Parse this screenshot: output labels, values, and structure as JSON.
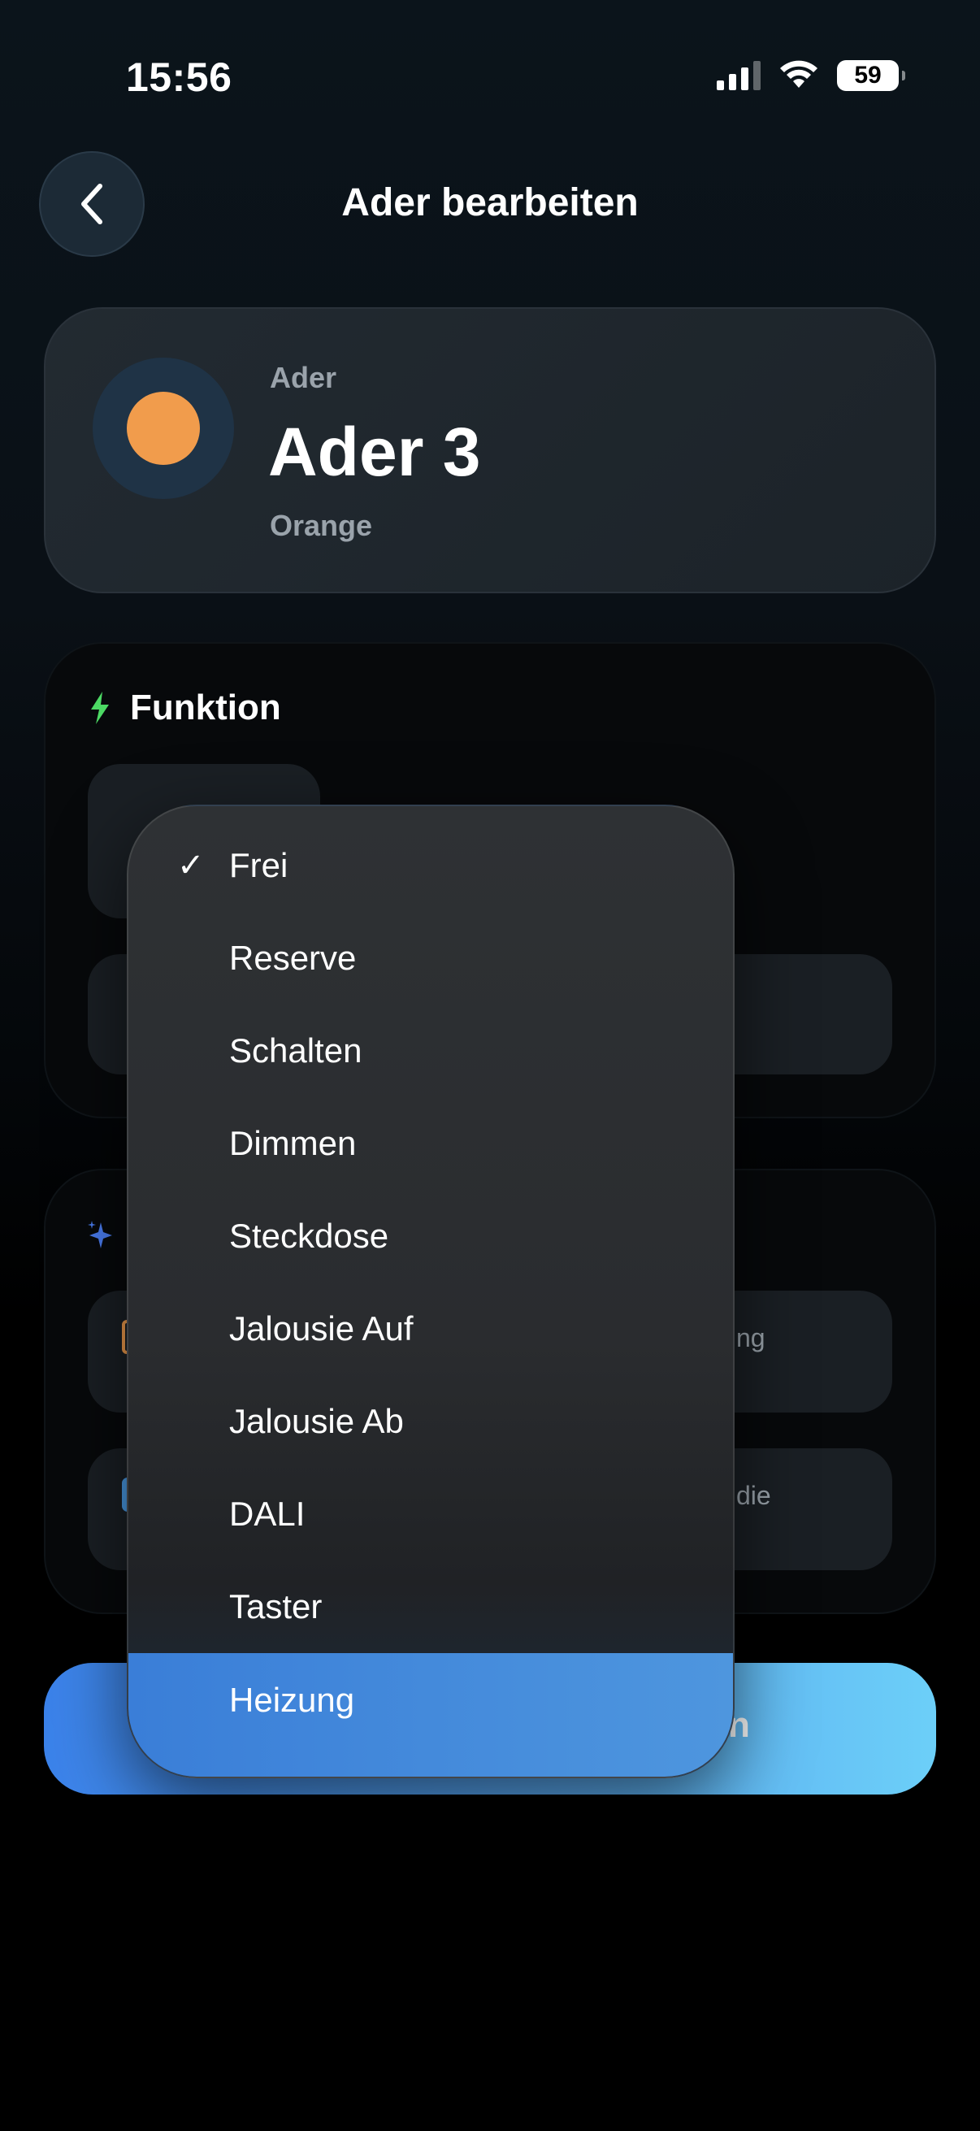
{
  "status": {
    "time": "15:56",
    "battery": "59"
  },
  "header": {
    "title": "Ader bearbeiten"
  },
  "wire": {
    "label": "Ader",
    "name": "Ader 3",
    "color_name": "Orange",
    "dot_color": "#f19c4c"
  },
  "function_section": {
    "title": "Funktion"
  },
  "dropdown": {
    "selected": "Frei",
    "items": [
      {
        "label": "Frei",
        "checked": true
      },
      {
        "label": "Reserve"
      },
      {
        "label": "Schalten"
      },
      {
        "label": "Dimmen"
      },
      {
        "label": "Steckdose"
      },
      {
        "label": "Jalousie Auf"
      },
      {
        "label": "Jalousie Ab"
      },
      {
        "label": "DALI"
      },
      {
        "label": "Taster"
      },
      {
        "label": "Heizung",
        "highlighted": true
      }
    ]
  },
  "background_fragments": {
    "row1_tail": "ng",
    "row2_tail": "die",
    "button_tail": "n"
  },
  "colors": {
    "accent": "#3b82ea",
    "accent_light": "#6ccff8",
    "function_icon": "#4cd964",
    "sparkle_icon": "#4a7df0"
  }
}
